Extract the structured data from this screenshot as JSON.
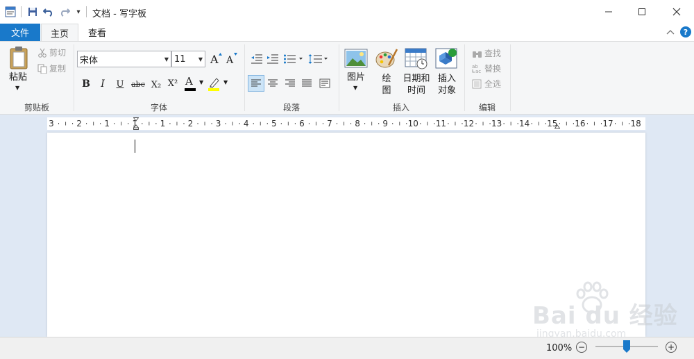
{
  "titlebar": {
    "title": "文档 - 写字板",
    "qa_customize_glyph": "▾",
    "minimize_glyph": "—",
    "maximize_glyph": "☐",
    "close_glyph": "✕"
  },
  "tabs": {
    "file": "文件",
    "home": "主页",
    "view": "查看"
  },
  "ribbon": {
    "help_glyph": "?",
    "collapse_glyph": "ˆ",
    "clipboard": {
      "paste": "粘贴",
      "cut": "剪切",
      "copy": "复制",
      "group_label": "剪贴板"
    },
    "font": {
      "family": "宋体",
      "size": "11",
      "bold": "B",
      "italic": "I",
      "underline": "U",
      "strike": "abc",
      "subscript": "X₂",
      "superscript": "X²",
      "color_letter": "A",
      "group_label": "字体"
    },
    "paragraph": {
      "group_label": "段落"
    },
    "insert": {
      "picture": "图片",
      "paint_line1": "绘",
      "paint_line2": "图",
      "datetime_line1": "日期和",
      "datetime_line2": "时间",
      "object_line1": "插入",
      "object_line2": "对象",
      "group_label": "插入"
    },
    "editing": {
      "find": "查找",
      "replace": "替换",
      "select_all": "全选",
      "group_label": "编辑"
    }
  },
  "ruler": {
    "labels": [
      "3",
      "2",
      "1",
      "1",
      "1",
      "2",
      "3",
      "4",
      "5",
      "6",
      "7",
      "8",
      "9",
      "10",
      "11",
      "12",
      "13",
      "14",
      "15",
      "16",
      "17",
      "18"
    ]
  },
  "status": {
    "zoom": "100%",
    "zoom_fraction": 0.5,
    "zoom_out": "−",
    "zoom_in": "+"
  },
  "watermark": {
    "text": "Bai du 经验",
    "url": "jingyan.baidu.com"
  },
  "colors": {
    "accent": "#1979ca",
    "ribbon_bg": "#f5f6f7",
    "doc_bg": "#dfe8f4",
    "font_color_bar": "#000000",
    "highlight_bar": "#ffff00"
  }
}
